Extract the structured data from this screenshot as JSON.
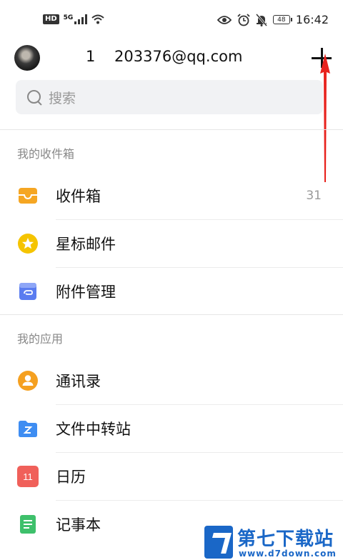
{
  "status_bar": {
    "network": "5G",
    "battery": "48",
    "time": "16:42"
  },
  "header": {
    "account": "1    203376@qq.com"
  },
  "search": {
    "placeholder": "搜索"
  },
  "inbox_section": {
    "title": "我的收件箱",
    "items": [
      {
        "label": "收件箱",
        "count": "31",
        "icon": "inbox-icon"
      },
      {
        "label": "星标邮件",
        "count": "",
        "icon": "star-icon"
      },
      {
        "label": "附件管理",
        "count": "",
        "icon": "attachment-icon"
      }
    ]
  },
  "apps_section": {
    "title": "我的应用",
    "items": [
      {
        "label": "通讯录",
        "icon": "contacts-icon"
      },
      {
        "label": "文件中转站",
        "icon": "folder-icon"
      },
      {
        "label": "日历",
        "icon": "calendar-icon",
        "badge": "11"
      },
      {
        "label": "记事本",
        "icon": "notebook-icon"
      }
    ]
  },
  "watermark": {
    "title": "第七下载站",
    "url": "www.d7down.com"
  },
  "colors": {
    "inbox": "#f5a623",
    "star": "#f5c400",
    "attachment": "#5a7cf0",
    "contacts": "#f5a020",
    "folder": "#3e8df2",
    "calendar": "#f0605a",
    "notebook": "#3ec06b",
    "arrow": "#e8231e"
  }
}
